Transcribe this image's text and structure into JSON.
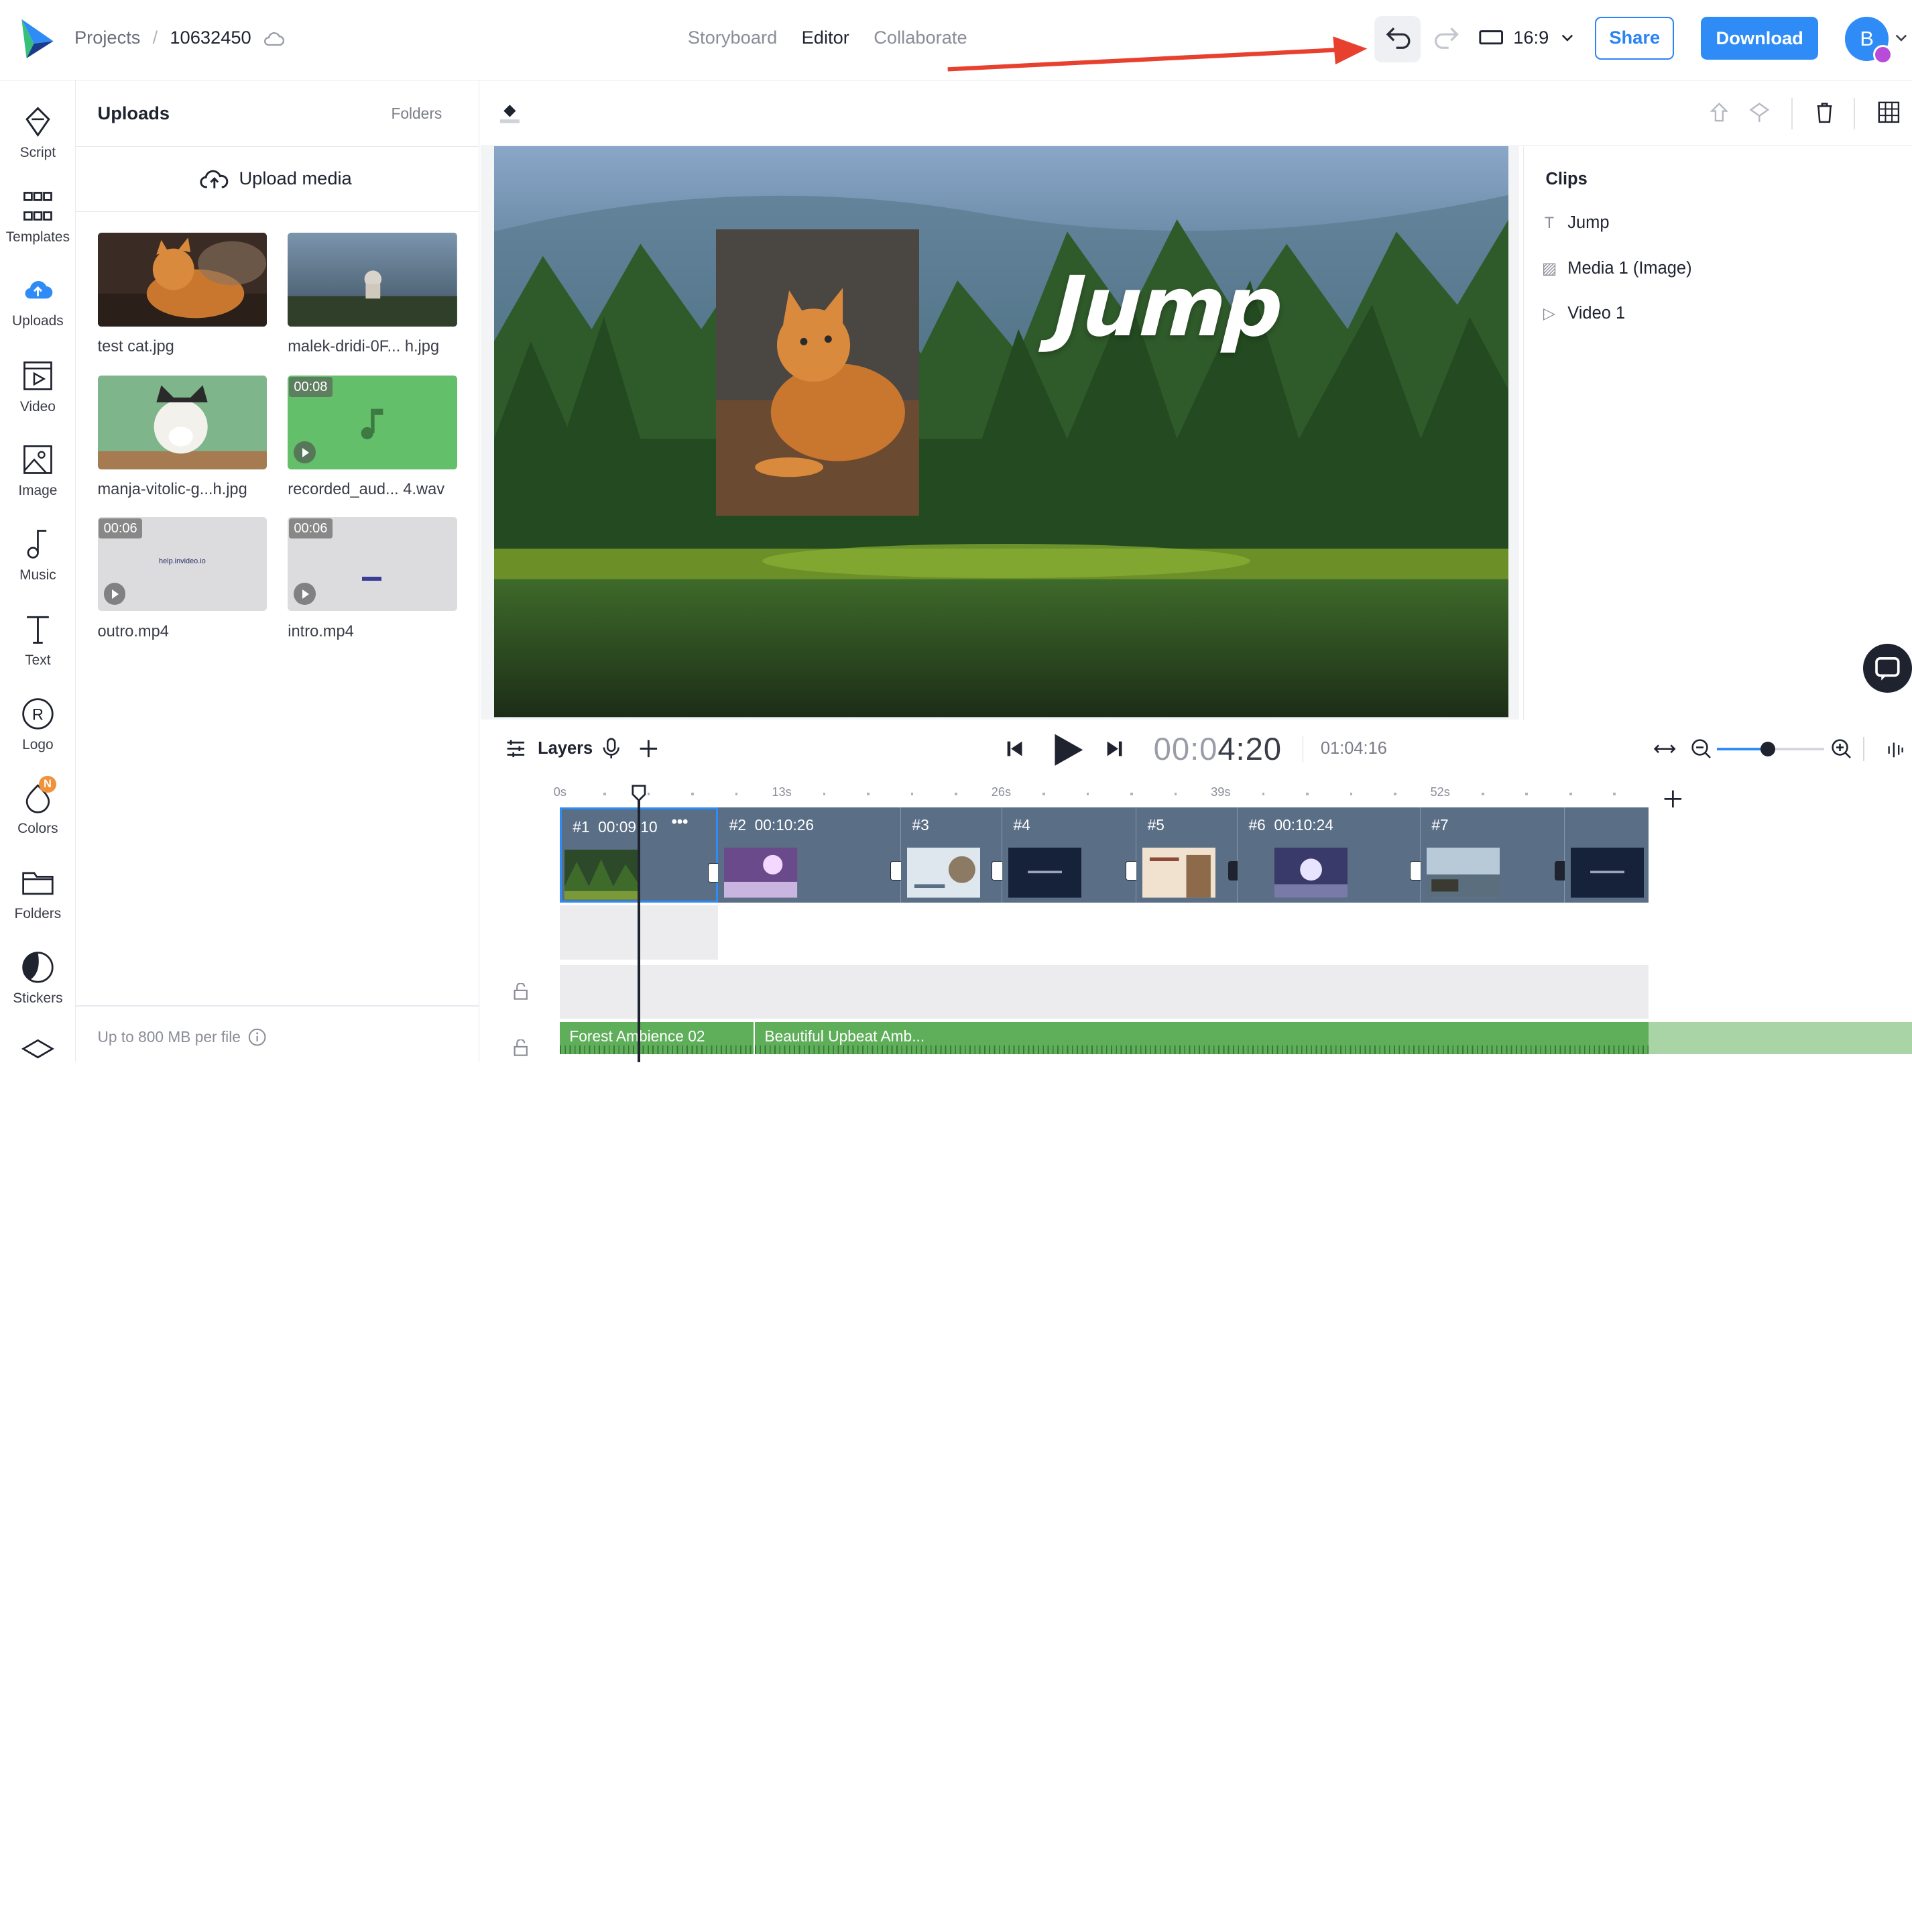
{
  "header": {
    "breadcrumb_root": "Projects",
    "breadcrumb_sep": "/",
    "project_id": "10632450",
    "tabs": [
      {
        "label": "Storyboard"
      },
      {
        "label": "Editor"
      },
      {
        "label": "Collaborate"
      }
    ],
    "aspect_ratio": "16:9",
    "share_label": "Share",
    "download_label": "Download",
    "avatar_initial": "B"
  },
  "rail": {
    "items": [
      {
        "label": "Script",
        "icon": "script-icon"
      },
      {
        "label": "Templates",
        "icon": "templates-icon"
      },
      {
        "label": "Uploads",
        "icon": "cloud-upload-icon"
      },
      {
        "label": "Video",
        "icon": "video-icon"
      },
      {
        "label": "Image",
        "icon": "image-icon"
      },
      {
        "label": "Music",
        "icon": "music-icon"
      },
      {
        "label": "Text",
        "icon": "text-icon"
      },
      {
        "label": "Logo",
        "icon": "logo-icon"
      },
      {
        "label": "Colors",
        "icon": "colors-icon"
      },
      {
        "label": "Folders",
        "icon": "folder-icon"
      },
      {
        "label": "Stickers",
        "icon": "stickers-icon"
      }
    ],
    "colors_badge": "N"
  },
  "uploads": {
    "title": "Uploads",
    "folders_label": "Folders",
    "upload_label": "Upload media",
    "files": [
      {
        "name": "test cat.jpg",
        "duration": ""
      },
      {
        "name": "malek-dridi-0F... h.jpg",
        "duration": ""
      },
      {
        "name": "manja-vitolic-g...h.jpg",
        "duration": ""
      },
      {
        "name": "recorded_aud... 4.wav",
        "duration": "00:08"
      },
      {
        "name": "outro.mp4",
        "duration": "00:06",
        "preview_text": "help.invideo.io"
      },
      {
        "name": "intro.mp4",
        "duration": "00:06"
      }
    ],
    "size_note": "Up to 800 MB per file"
  },
  "canvas": {
    "overlay_text": "Jump"
  },
  "clips": {
    "title": "Clips",
    "items": [
      {
        "label": "Jump",
        "icon": "text-T-icon"
      },
      {
        "label": "Media 1 (Image)",
        "icon": "image-icon"
      },
      {
        "label": "Video 1",
        "icon": "play-icon"
      }
    ]
  },
  "timeline": {
    "layers_label": "Layers",
    "timecode_dim": "00:0",
    "timecode_bright": "4:20",
    "total": "01:04:16",
    "ruler_labels": [
      "0s",
      "13s",
      "26s",
      "39s",
      "52s"
    ],
    "scenes": [
      {
        "label": "#1",
        "time": "00:09:10"
      },
      {
        "label": "#2",
        "time": "00:10:26"
      },
      {
        "label": "#3",
        "time": ""
      },
      {
        "label": "#4",
        "time": ""
      },
      {
        "label": "#5",
        "time": ""
      },
      {
        "label": "#6",
        "time": "00:10:24"
      },
      {
        "label": "#7",
        "time": ""
      }
    ],
    "scene_menu": "•••",
    "audio_clips": [
      {
        "label": "Forest Ambience 02"
      },
      {
        "label": "Beautiful Upbeat Amb..."
      }
    ]
  },
  "colors": {
    "accent": "#2f8cf6",
    "scene_bg": "#5a6e86",
    "audio": "#5fae5a",
    "arrow": "#e8402e"
  }
}
